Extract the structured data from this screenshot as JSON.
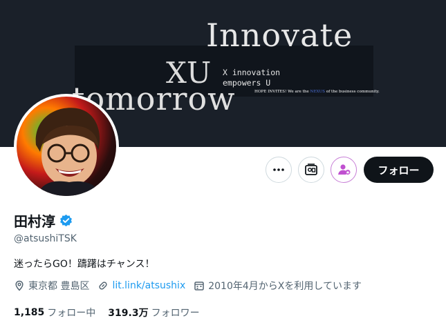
{
  "banner": {
    "headline_top": "Innovate",
    "headline_bottom": "tomorrow",
    "logo": "XU",
    "tagline_line1": "X innovation",
    "tagline_line2": "empowers U",
    "small_text_part1": "HOPE INVITES! We are the ",
    "small_text_highlight": "NEXUS",
    "small_text_part2": " of the business community."
  },
  "actions": {
    "more_icon": "more-dots-icon",
    "subscribe_icon": "subscription-icon",
    "notify_icon": "notification-person-icon",
    "follow_label": "フォロー"
  },
  "profile": {
    "name": "田村淳",
    "verified": true,
    "handle": "@atsushiTSK",
    "bio": "迷ったらGO！躊躇はチャンス！",
    "location": "東京都 豊島区",
    "link": "lit.link/atsushix",
    "joined": "2010年4月からXを利用しています"
  },
  "stats": {
    "following_count": "1,185",
    "following_label": "フォロー中",
    "followers_count": "319.3万",
    "followers_label": "フォロワー"
  },
  "colors": {
    "accent": "#1d9bf0",
    "text_primary": "#0f1419",
    "text_secondary": "#536471",
    "banner_bg": "#1a2029"
  }
}
